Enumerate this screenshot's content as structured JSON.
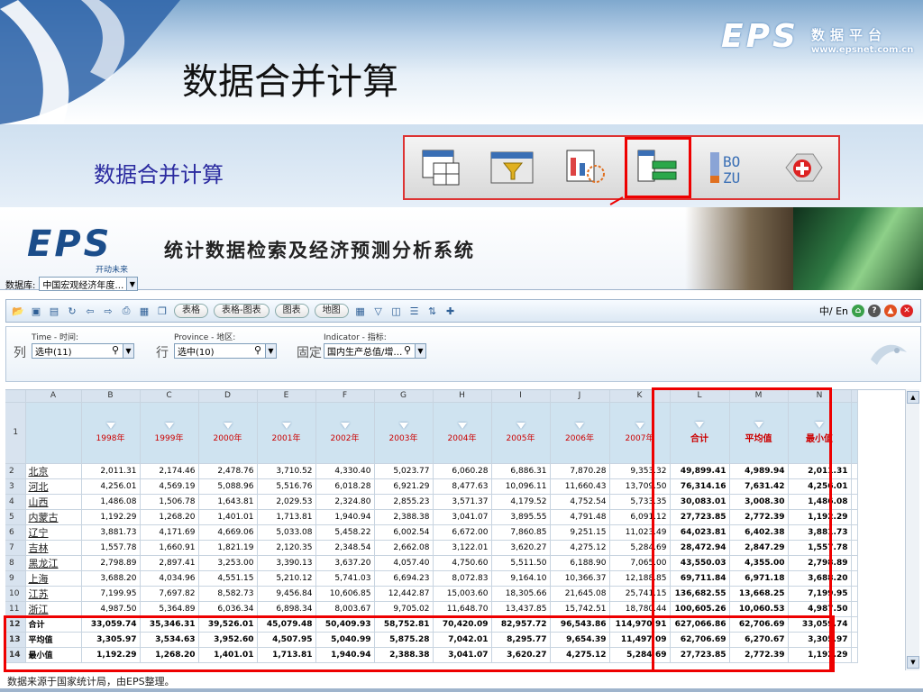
{
  "slide": {
    "title": "数据合并计算",
    "subtitle": "数据合并计算",
    "brand_logo": "EPS",
    "brand_cn": "数据平台",
    "brand_url": "www.epsnet.com.cn"
  },
  "toolbar_icons": [
    "table-icon",
    "filter-icon",
    "chart-icon",
    "merge-icon",
    "sort-icon",
    "add-icon"
  ],
  "app": {
    "logo": "EPS",
    "logo_sub": "开动未来",
    "name": "统计数据检索及经济预测分析系统",
    "db_label": "数据库:",
    "db_value": "中国宏观经济年度…"
  },
  "toolbar": {
    "btn_table": "表格",
    "btn_table_chart": "表格-图表",
    "btn_chart": "图表",
    "btn_map": "地图",
    "lang": "中/ En"
  },
  "filters": {
    "time_caption": "Time - 时间:",
    "province_caption": "Province - 地区:",
    "indicator_caption": "Indicator - 指标:",
    "col_label": "列",
    "row_label": "行",
    "fixed_label": "固定",
    "time_value": "选中(11)",
    "province_value": "选中(10)",
    "indicator_value": "国内生产总值/增…"
  },
  "sheet": {
    "col_letters": [
      "A",
      "B",
      "C",
      "D",
      "E",
      "F",
      "G",
      "H",
      "I",
      "J",
      "K",
      "L",
      "M",
      "N"
    ],
    "years": [
      "1998年",
      "1999年",
      "2000年",
      "2001年",
      "2002年",
      "2003年",
      "2004年",
      "2005年",
      "2006年",
      "2007年"
    ],
    "agg_headers": [
      "合计",
      "平均值",
      "最小值"
    ],
    "rows": [
      {
        "n": "2",
        "name": "北京",
        "vals": [
          "2,011.31",
          "2,174.46",
          "2,478.76",
          "3,710.52",
          "4,330.40",
          "5,023.77",
          "6,060.28",
          "6,886.31",
          "7,870.28",
          "9,353.32"
        ],
        "agg": [
          "49,899.41",
          "4,989.94",
          "2,011.31"
        ]
      },
      {
        "n": "3",
        "name": "河北",
        "vals": [
          "4,256.01",
          "4,569.19",
          "5,088.96",
          "5,516.76",
          "6,018.28",
          "6,921.29",
          "8,477.63",
          "10,096.11",
          "11,660.43",
          "13,709.50"
        ],
        "agg": [
          "76,314.16",
          "7,631.42",
          "4,256.01"
        ]
      },
      {
        "n": "4",
        "name": "山西",
        "vals": [
          "1,486.08",
          "1,506.78",
          "1,643.81",
          "2,029.53",
          "2,324.80",
          "2,855.23",
          "3,571.37",
          "4,179.52",
          "4,752.54",
          "5,733.35"
        ],
        "agg": [
          "30,083.01",
          "3,008.30",
          "1,486.08"
        ]
      },
      {
        "n": "5",
        "name": "内蒙古",
        "vals": [
          "1,192.29",
          "1,268.20",
          "1,401.01",
          "1,713.81",
          "1,940.94",
          "2,388.38",
          "3,041.07",
          "3,895.55",
          "4,791.48",
          "6,091.12"
        ],
        "agg": [
          "27,723.85",
          "2,772.39",
          "1,192.29"
        ]
      },
      {
        "n": "6",
        "name": "辽宁",
        "vals": [
          "3,881.73",
          "4,171.69",
          "4,669.06",
          "5,033.08",
          "5,458.22",
          "6,002.54",
          "6,672.00",
          "7,860.85",
          "9,251.15",
          "11,023.49"
        ],
        "agg": [
          "64,023.81",
          "6,402.38",
          "3,881.73"
        ]
      },
      {
        "n": "7",
        "name": "吉林",
        "vals": [
          "1,557.78",
          "1,660.91",
          "1,821.19",
          "2,120.35",
          "2,348.54",
          "2,662.08",
          "3,122.01",
          "3,620.27",
          "4,275.12",
          "5,284.69"
        ],
        "agg": [
          "28,472.94",
          "2,847.29",
          "1,557.78"
        ]
      },
      {
        "n": "8",
        "name": "黑龙江",
        "vals": [
          "2,798.89",
          "2,897.41",
          "3,253.00",
          "3,390.13",
          "3,637.20",
          "4,057.40",
          "4,750.60",
          "5,511.50",
          "6,188.90",
          "7,065.00"
        ],
        "agg": [
          "43,550.03",
          "4,355.00",
          "2,798.89"
        ]
      },
      {
        "n": "9",
        "name": "上海",
        "vals": [
          "3,688.20",
          "4,034.96",
          "4,551.15",
          "5,210.12",
          "5,741.03",
          "6,694.23",
          "8,072.83",
          "9,164.10",
          "10,366.37",
          "12,188.85"
        ],
        "agg": [
          "69,711.84",
          "6,971.18",
          "3,688.20"
        ]
      },
      {
        "n": "10",
        "name": "江苏",
        "vals": [
          "7,199.95",
          "7,697.82",
          "8,582.73",
          "9,456.84",
          "10,606.85",
          "12,442.87",
          "15,003.60",
          "18,305.66",
          "21,645.08",
          "25,741.15"
        ],
        "agg": [
          "136,682.55",
          "13,668.25",
          "7,199.95"
        ]
      },
      {
        "n": "11",
        "name": "浙江",
        "vals": [
          "4,987.50",
          "5,364.89",
          "6,036.34",
          "6,898.34",
          "8,003.67",
          "9,705.02",
          "11,648.70",
          "13,437.85",
          "15,742.51",
          "18,780.44"
        ],
        "agg": [
          "100,605.26",
          "10,060.53",
          "4,987.50"
        ]
      }
    ],
    "summary": [
      {
        "n": "12",
        "name": "合计",
        "vals": [
          "33,059.74",
          "35,346.31",
          "39,526.01",
          "45,079.48",
          "50,409.93",
          "58,752.81",
          "70,420.09",
          "82,957.72",
          "96,543.86",
          "114,970.91"
        ],
        "agg": [
          "627,066.86",
          "62,706.69",
          "33,059.74"
        ]
      },
      {
        "n": "13",
        "name": "平均值",
        "vals": [
          "3,305.97",
          "3,534.63",
          "3,952.60",
          "4,507.95",
          "5,040.99",
          "5,875.28",
          "7,042.01",
          "8,295.77",
          "9,654.39",
          "11,497.09"
        ],
        "agg": [
          "62,706.69",
          "6,270.67",
          "3,305.97"
        ]
      },
      {
        "n": "14",
        "name": "最小值",
        "vals": [
          "1,192.29",
          "1,268.20",
          "1,401.01",
          "1,713.81",
          "1,940.94",
          "2,388.38",
          "3,041.07",
          "3,620.27",
          "4,275.12",
          "5,284.69"
        ],
        "agg": [
          "27,723.85",
          "2,772.39",
          "1,192.29"
        ]
      }
    ],
    "header_row_num": "1"
  },
  "footer": "数据来源于国家统计局，由EPS整理。"
}
